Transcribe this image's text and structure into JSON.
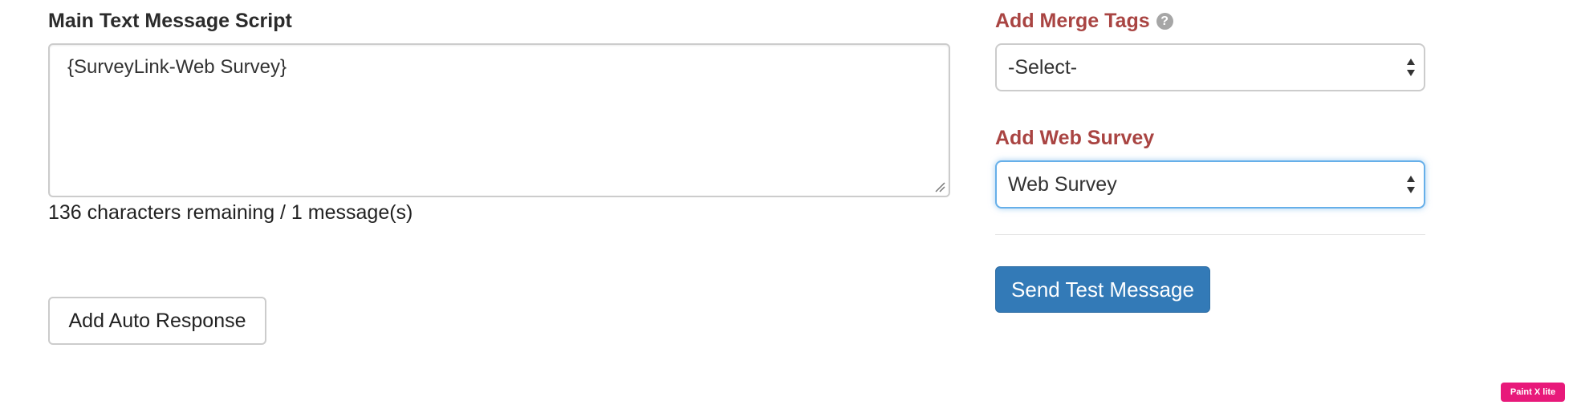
{
  "main_script": {
    "label": "Main Text Message Script",
    "value": "{SurveyLink-Web Survey}",
    "counter_text": "136 characters remaining / 1 message(s)"
  },
  "auto_response": {
    "button_label": "Add Auto Response"
  },
  "merge_tags": {
    "label": "Add Merge Tags",
    "help_icon": "?",
    "selected": "-Select-"
  },
  "web_survey": {
    "label": "Add Web Survey",
    "selected": "Web Survey"
  },
  "send_test": {
    "button_label": "Send Test Message"
  },
  "watermark": {
    "text": "Paint X lite"
  },
  "colors": {
    "label_red": "#a94442",
    "primary": "#337ab7",
    "focus": "#66afe9",
    "badge": "#e8197a"
  }
}
